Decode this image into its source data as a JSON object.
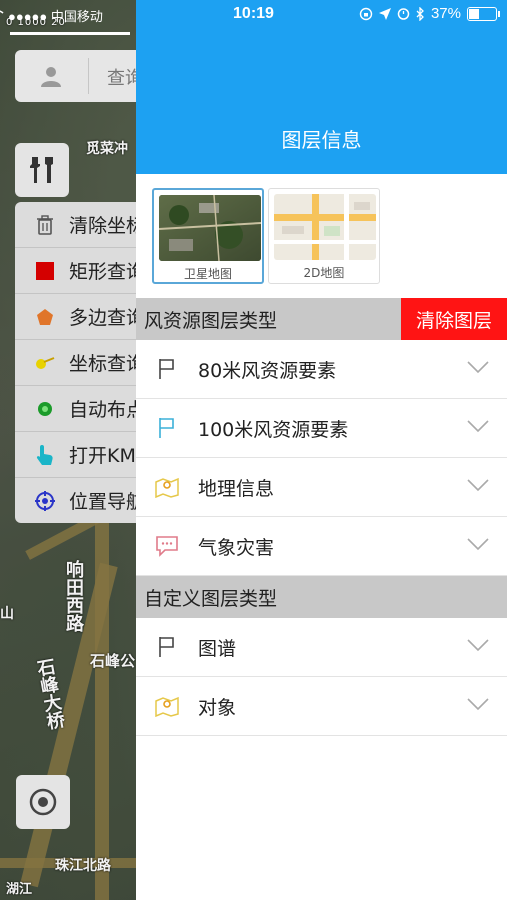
{
  "status_bar": {
    "carrier": "●●●●● 中国移动",
    "time": "10:19",
    "battery": "37%",
    "battery_level": 0.37
  },
  "map": {
    "scale_labels": "0      1000      20",
    "labels": [
      "觅菜冲",
      "响田西路",
      "石峰大桥",
      "石峰公",
      "珠江北路",
      "山",
      "湖江"
    ],
    "search_placeholder": "查询",
    "tools_menu": [
      {
        "label": "清除坐标",
        "icon": "trash-icon"
      },
      {
        "label": "矩形查询",
        "icon": "red-square-icon"
      },
      {
        "label": "多边查询",
        "icon": "orange-pentagon-icon"
      },
      {
        "label": "坐标查询",
        "icon": "pin-icon"
      },
      {
        "label": "自动布点",
        "icon": "green-dot-icon"
      },
      {
        "label": "打开KML",
        "icon": "hand-pointer-icon"
      },
      {
        "label": "位置导航",
        "icon": "crosshair-icon"
      }
    ]
  },
  "panel": {
    "title": "图层信息",
    "basemaps": [
      {
        "caption": "卫星地图",
        "selected": true
      },
      {
        "caption": "2D地图",
        "selected": false
      }
    ],
    "wind_section": {
      "title": "风资源图层类型",
      "clear_label": "清除图层",
      "items": [
        {
          "label": "80米风资源要素",
          "icon": "flag-outline-icon"
        },
        {
          "label": "100米风资源要素",
          "icon": "flag-blue-icon"
        },
        {
          "label": "地理信息",
          "icon": "map-pin-icon"
        },
        {
          "label": "气象灾害",
          "icon": "chat-bubble-icon"
        }
      ]
    },
    "custom_section": {
      "title": "自定义图层类型",
      "items": [
        {
          "label": "图谱",
          "icon": "flag-outline-icon"
        },
        {
          "label": "对象",
          "icon": "map-pin-icon"
        }
      ]
    }
  },
  "colors": {
    "header_blue": "#1da1f2",
    "clear_red": "#ff1414",
    "section_gray": "#c8c8c8"
  }
}
